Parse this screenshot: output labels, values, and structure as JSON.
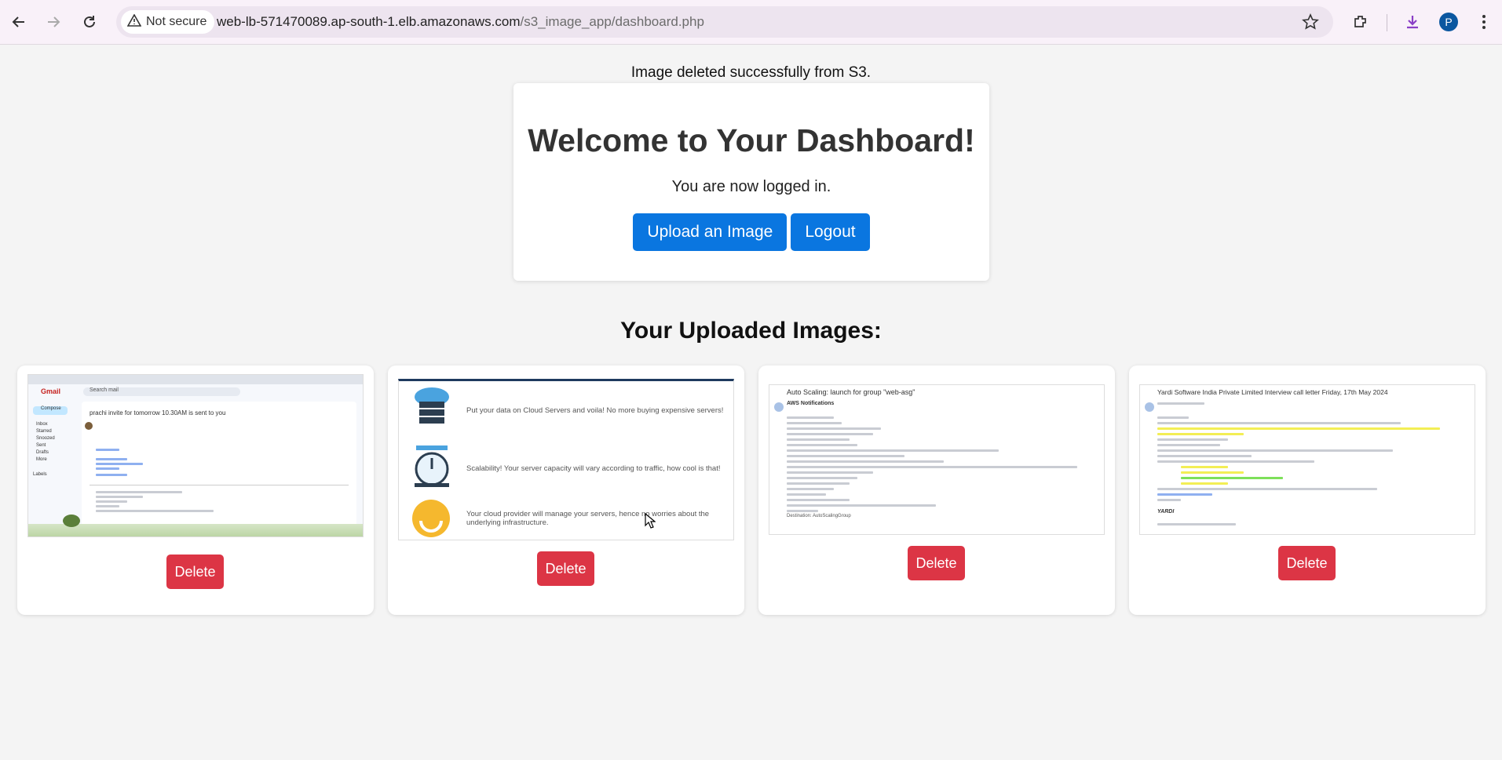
{
  "browser": {
    "security_label": "Not secure",
    "url_host": "web-lb-571470089.ap-south-1.elb.amazonaws.com",
    "url_path": "/s3_image_app/dashboard.php",
    "profile_initial": "P",
    "icons": [
      "back-icon",
      "forward-icon",
      "reload-icon",
      "warning-icon",
      "star-icon",
      "extensions-icon",
      "download-icon",
      "menu-icon"
    ]
  },
  "flash_message": "Image deleted successfully from S3.",
  "welcome": {
    "title": "Welcome to Your Dashboard!",
    "subtitle": "You are now logged in.",
    "upload_label": "Upload an Image",
    "logout_label": "Logout"
  },
  "uploads": {
    "title": "Your Uploaded Images:",
    "delete_label": "Delete",
    "items": [
      {
        "kind": "gmail",
        "app": "Gmail",
        "subject": "prachi invite for tomorrow 10.30AM is sent to you",
        "search": "Search mail",
        "compose": "Compose",
        "folders": [
          "Inbox",
          "Starred",
          "Snoozed",
          "Sent",
          "Drafts",
          "More"
        ],
        "labels": "Labels"
      },
      {
        "kind": "infographic",
        "rows": [
          "Put your data on Cloud Servers and voila! No more buying expensive servers!",
          "Scalability! Your server capacity will vary according to traffic, how cool is that!",
          "Your cloud provider will manage your servers, hence no worries about the underlying infrastructure."
        ]
      },
      {
        "kind": "email",
        "subject": "Auto Scaling: launch for group \"web-asg\"",
        "sender": "AWS Notifications",
        "last_line": "Destination: AutoScalingGroup"
      },
      {
        "kind": "email",
        "subject": "Yardi Software India Private Limited Interview call letter Friday, 17th May 2024",
        "brand": "YARDI"
      }
    ]
  },
  "colors": {
    "primary": "#0a76e0",
    "danger": "#dc3545",
    "page_bg": "#f4f4f4",
    "chrome_bg": "#f9f1f9"
  }
}
